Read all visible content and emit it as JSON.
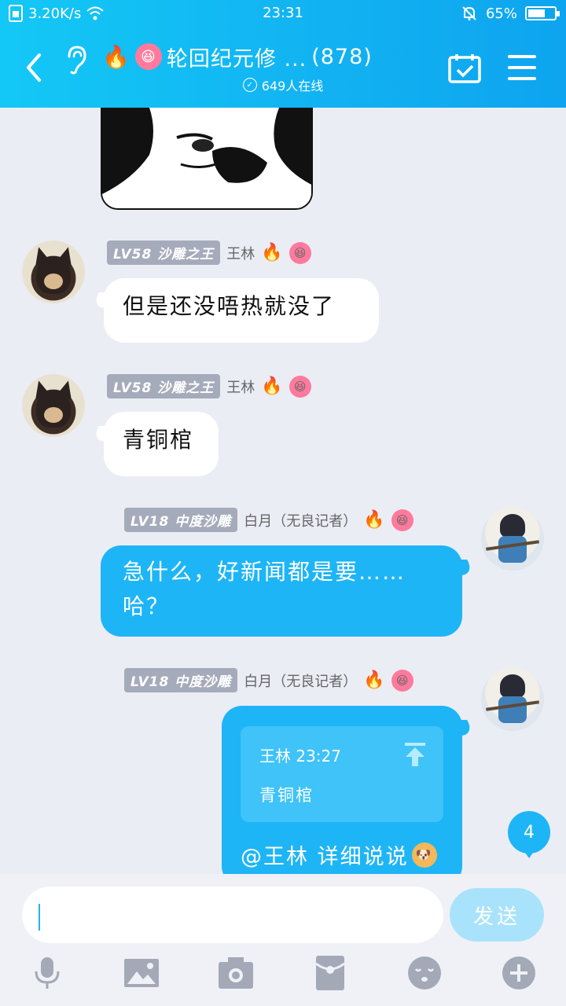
{
  "status_bar": {
    "network_speed": "3.20K/s",
    "time": "23:31",
    "battery": "65%",
    "battery_level": 0.65
  },
  "header": {
    "title": "轮回纪元修 ...",
    "member_count": "(878)",
    "online_text": "649人在线",
    "title_emojis": [
      "fire-emoji",
      "laughing-face-emoji"
    ]
  },
  "messages": [
    {
      "sender_name": "王林",
      "level": "LV58",
      "rank": "沙雕之王",
      "text": "但是还没唔热就没了",
      "side": "left"
    },
    {
      "sender_name": "王林",
      "level": "LV58",
      "rank": "沙雕之王",
      "text": "青铜棺",
      "side": "left"
    },
    {
      "sender_name": "白月（无良记者）",
      "level": "LV18",
      "rank": "中度沙雕",
      "text_line1": "急什么，好新闻都是要……",
      "text_line2": "哈？",
      "side": "right"
    },
    {
      "sender_name": "白月（无良记者）",
      "level": "LV18",
      "rank": "中度沙雕",
      "quote_sender": "王林 23:27",
      "quote_text": "青铜棺",
      "at_text": "@王林 详细说说",
      "side": "right"
    }
  ],
  "unread_count": "4",
  "input": {
    "value": "",
    "placeholder": "",
    "send_label": "发送"
  },
  "toolbar": [
    "microphone-icon",
    "image-icon",
    "camera-icon",
    "red-packet-icon",
    "emoji-icon",
    "plus-icon"
  ]
}
